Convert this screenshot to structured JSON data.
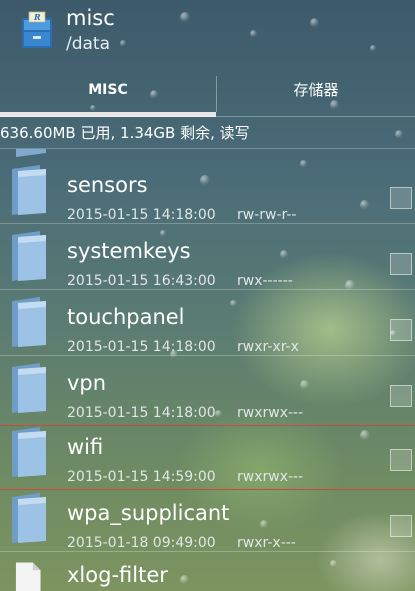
{
  "header": {
    "title": "misc",
    "path": "/data"
  },
  "tabs": [
    {
      "label": "MISC",
      "active": true
    },
    {
      "label": "存储器",
      "active": false
    }
  ],
  "status": {
    "text": "636.60MB 已用, 1.34GB 剩余, 读写"
  },
  "files": [
    {
      "name": "sensors",
      "date": "2015-01-15 14:18:00",
      "perms": "rw-rw-r--",
      "type": "folder"
    },
    {
      "name": "systemkeys",
      "date": "2015-01-15 16:43:00",
      "perms": "rwx------",
      "type": "folder"
    },
    {
      "name": "touchpanel",
      "date": "2015-01-15 14:18:00",
      "perms": "rwxr-xr-x",
      "type": "folder"
    },
    {
      "name": "vpn",
      "date": "2015-01-15 14:18:00",
      "perms": "rwxrwx---",
      "type": "folder"
    },
    {
      "name": "wifi",
      "date": "2015-01-15 14:59:00",
      "perms": "rwxrwx---",
      "type": "folder"
    },
    {
      "name": "wpa_supplicant",
      "date": "2015-01-18 09:49:00",
      "perms": "rwxr-x---",
      "type": "folder"
    },
    {
      "name": "xlog-filter",
      "type": "file"
    }
  ],
  "colors": {
    "accent_separator": "#c94a3e",
    "tab_indicator": "#e7e7e7"
  },
  "icons": {
    "app": "root-explorer-icon",
    "folder": "folder-icon",
    "file": "file-icon"
  }
}
